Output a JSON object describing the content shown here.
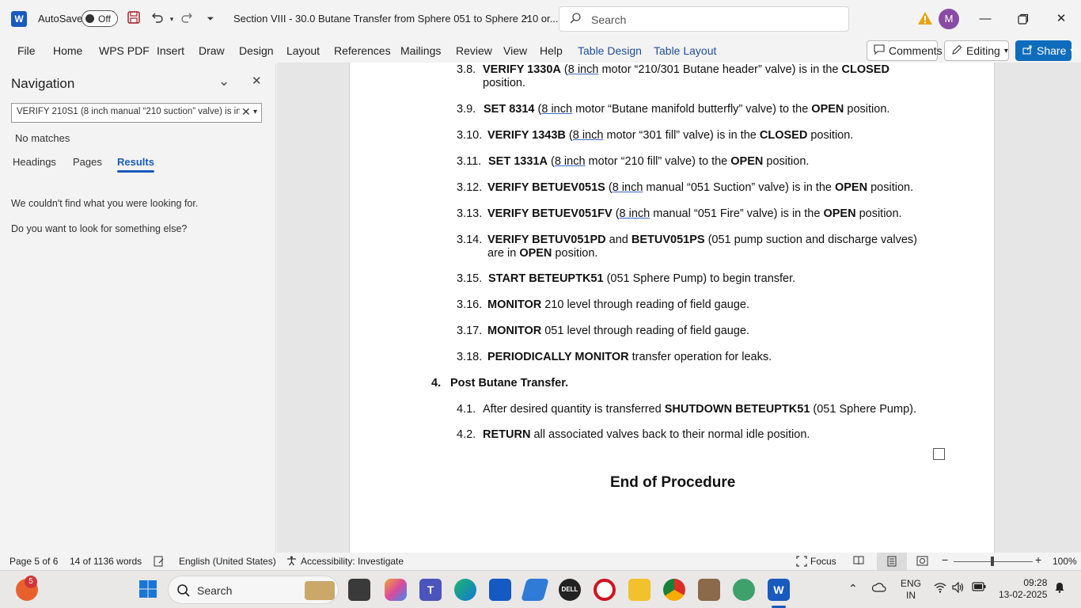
{
  "titlebar": {
    "app_logo": "W",
    "autosave_label": "AutoSave",
    "autosave_state": "Off",
    "document_title": "Section VIII - 30.0 Butane Transfer from Sphere 051 to Sphere 210 or...",
    "search_placeholder": "Search",
    "avatar_initial": "M",
    "icons": [
      "save-icon",
      "undo-icon",
      "redo-icon",
      "customize-icon",
      "warning-icon"
    ]
  },
  "ribbon": {
    "tabs": [
      "File",
      "Home",
      "WPS PDF",
      "Insert",
      "Draw",
      "Design",
      "Layout",
      "References",
      "Mailings",
      "Review",
      "View",
      "Help",
      "Table Design",
      "Table Layout"
    ],
    "comments_label": "Comments",
    "editing_label": "Editing",
    "share_label": "Share"
  },
  "navigation": {
    "title": "Navigation",
    "search_value": "VERIFY 210S1 (8 inch manual “210 suction” valve) is in the",
    "status": "No matches",
    "tabs": [
      "Headings",
      "Pages",
      "Results"
    ],
    "active_tab": "Results",
    "message_1": "We couldn't find what you were looking for.",
    "message_2": "Do you want to look for something else?"
  },
  "document": {
    "steps": [
      {
        "num": "3.8.",
        "parts": [
          [
            "b",
            "VERIFY 1330A"
          ],
          [
            "t",
            " ("
          ],
          [
            "u",
            "8 inch"
          ],
          [
            "t",
            " motor “210/301 Butane header” valve) is in the "
          ],
          [
            "b",
            "CLOSED"
          ]
        ],
        "cont": "position."
      },
      {
        "num": "3.9.",
        "parts": [
          [
            "b",
            "SET 8314"
          ],
          [
            "t",
            " ("
          ],
          [
            "u",
            "8 inch"
          ],
          [
            "t",
            " motor “Butane manifold butterfly” valve) to the "
          ],
          [
            "b",
            "OPEN"
          ],
          [
            "t",
            " position."
          ]
        ]
      },
      {
        "num": "3.10.",
        "parts": [
          [
            "b",
            "VERIFY 1343B"
          ],
          [
            "t",
            " ("
          ],
          [
            "u",
            "8 inch"
          ],
          [
            "t",
            " motor “301 fill” valve) is in the "
          ],
          [
            "b",
            "CLOSED"
          ],
          [
            "t",
            " position."
          ]
        ]
      },
      {
        "num": "3.11.",
        "parts": [
          [
            "b",
            "SET 1331A"
          ],
          [
            "t",
            " ("
          ],
          [
            "u",
            "8 inch"
          ],
          [
            "t",
            " motor “210 fill” valve) to the "
          ],
          [
            "b",
            "OPEN"
          ],
          [
            "t",
            " position."
          ]
        ]
      },
      {
        "num": "3.12.",
        "parts": [
          [
            "b",
            "VERIFY BETUEV051S"
          ],
          [
            "t",
            " ("
          ],
          [
            "u",
            "8 inch"
          ],
          [
            "t",
            " manual “051 Suction” valve) is in the "
          ],
          [
            "b",
            "OPEN"
          ],
          [
            "t",
            " position."
          ]
        ]
      },
      {
        "num": "3.13.",
        "parts": [
          [
            "b",
            "VERIFY BETUEV051FV"
          ],
          [
            "t",
            " ("
          ],
          [
            "u",
            "8 inch"
          ],
          [
            "t",
            " manual “051 Fire” valve) is in the "
          ],
          [
            "b",
            "OPEN"
          ],
          [
            "t",
            " position."
          ]
        ]
      },
      {
        "num": "3.14.",
        "parts": [
          [
            "b",
            "VERIFY BETUV051PD"
          ],
          [
            "t",
            " and "
          ],
          [
            "b",
            "BETUV051PS"
          ],
          [
            "t",
            " (051 pump suction and discharge valves)"
          ]
        ],
        "cont_parts": [
          [
            "t",
            "are in "
          ],
          [
            "b",
            "OPEN"
          ],
          [
            "t",
            " position."
          ]
        ]
      },
      {
        "num": "3.15.",
        "parts": [
          [
            "b",
            "START BETEUPTK51"
          ],
          [
            "t",
            " (051 Sphere Pump) to begin transfer."
          ]
        ]
      },
      {
        "num": "3.16.",
        "parts": [
          [
            "b",
            "MONITOR"
          ],
          [
            "t",
            " 210 level through reading of field gauge."
          ]
        ]
      },
      {
        "num": "3.17.",
        "parts": [
          [
            "b",
            "MONITOR"
          ],
          [
            "t",
            " 051 level through reading of field gauge."
          ]
        ]
      },
      {
        "num": "3.18.",
        "parts": [
          [
            "b",
            "PERIODICALLY MONITOR"
          ],
          [
            "t",
            " transfer operation for leaks."
          ]
        ]
      }
    ],
    "section_num": "4.",
    "section_title": "Post Butane Transfer.",
    "substeps": [
      {
        "num": "4.1.",
        "parts": [
          [
            "t",
            "After desired quantity is transferred "
          ],
          [
            "b",
            "SHUTDOWN BETEUPTK51"
          ],
          [
            "t",
            " (051 Sphere Pump)."
          ]
        ]
      },
      {
        "num": "4.2.",
        "parts": [
          [
            "b",
            "RETURN"
          ],
          [
            "t",
            " all associated valves back to their normal idle position."
          ]
        ]
      }
    ],
    "end_text": "End of Procedure"
  },
  "statusbar": {
    "page": "Page 5 of 6",
    "words": "14 of 1136 words",
    "language": "English (United States)",
    "accessibility": "Accessibility: Investigate",
    "focus": "Focus",
    "zoom": "100%"
  },
  "taskbar": {
    "search_label": "Search",
    "notification_badge": "5",
    "language_line1": "ENG",
    "language_line2": "IN",
    "time": "09:28",
    "date": "13-02-2025"
  }
}
